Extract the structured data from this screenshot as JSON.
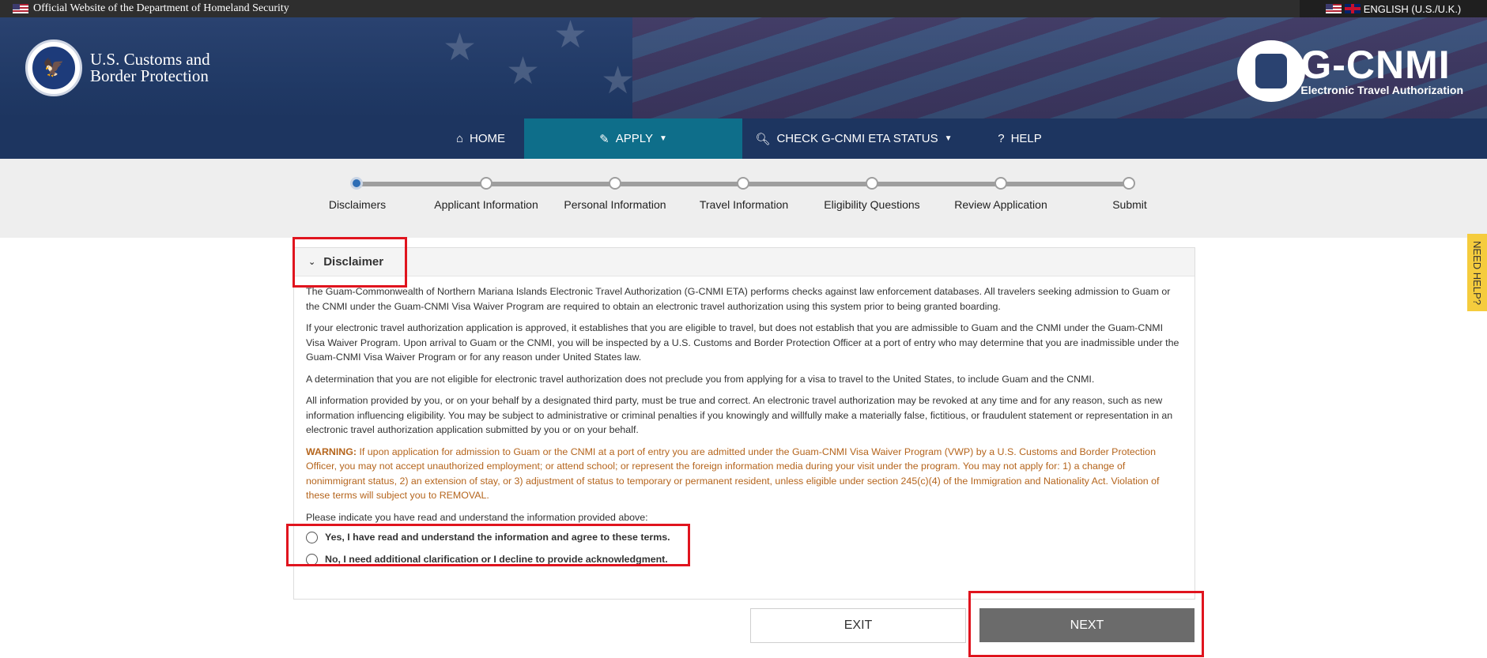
{
  "gov_bar": {
    "official_text": "Official Website of the Department of Homeland Security",
    "language": "ENGLISH (U.S./U.K.)"
  },
  "header": {
    "cbp_line1": "U.S. Customs and",
    "cbp_line2": "Border Protection",
    "brand_title": "G-CNMI",
    "brand_subtitle": "Electronic Travel Authorization"
  },
  "nav": {
    "home": "HOME",
    "apply": "APPLY",
    "check_status": "CHECK G-CNMI ETA STATUS",
    "help": "HELP"
  },
  "progress": {
    "current_step_index": 0,
    "steps": [
      "Disclaimers",
      "Applicant Information",
      "Personal Information",
      "Travel Information",
      "Eligibility Questions",
      "Review Application",
      "Submit"
    ]
  },
  "disclaimer": {
    "title": "Disclaimer",
    "p1": "The Guam-Commonwealth of Northern Mariana Islands Electronic Travel Authorization (G-CNMI ETA) performs checks against law enforcement databases. All travelers seeking admission to Guam or the CNMI under the Guam-CNMI Visa Waiver Program are required to obtain an electronic travel authorization using this system prior to being granted boarding.",
    "p2": "If your electronic travel authorization application is approved, it establishes that you are eligible to travel, but does not establish that you are admissible to Guam and the CNMI under the Guam-CNMI Visa Waiver Program. Upon arrival to Guam or the CNMI, you will be inspected by a U.S. Customs and Border Protection Officer at a port of entry who may determine that you are inadmissible under the Guam-CNMI Visa Waiver Program or for any reason under United States law.",
    "p3": "A determination that you are not eligible for electronic travel authorization does not preclude you from applying for a visa to travel to the United States, to include Guam and the CNMI.",
    "p4": "All information provided by you, or on your behalf by a designated third party, must be true and correct. An electronic travel authorization may be revoked at any time and for any reason, such as new information influencing eligibility. You may be subject to administrative or criminal penalties if you knowingly and willfully make a materially false, fictitious, or fraudulent statement or representation in an electronic travel authorization application submitted by you or on your behalf.",
    "warning_label": "WARNING:",
    "warning_text": " If upon application for admission to Guam or the CNMI at a port of entry you are admitted under the Guam-CNMI Visa Waiver Program (VWP) by a U.S. Customs and Border Protection Officer, you may not accept unauthorized employment; or attend school; or represent the foreign information media during your visit under the program. You may not apply for: 1) a change of nonimmigrant status, 2) an extension of stay, or 3) adjustment of status to temporary or permanent resident, unless eligible under section 245(c)(4) of the Immigration and Nationality Act. Violation of these terms will subject you to REMOVAL.",
    "prompt": "Please indicate you have read and understand the information provided above:",
    "option_yes": "Yes, I have read and understand the information and agree to these terms.",
    "option_no": "No, I need additional clarification or I decline to provide acknowledgment."
  },
  "buttons": {
    "exit": "EXIT",
    "next": "NEXT"
  },
  "need_help": "NEED HELP?",
  "colors": {
    "nav_bg": "#1d3560",
    "nav_active": "#0e6e8a",
    "warning": "#b5651d",
    "highlight": "#e0141e",
    "next_button": "#6b6b6b",
    "help_tab": "#f5cc3d"
  }
}
